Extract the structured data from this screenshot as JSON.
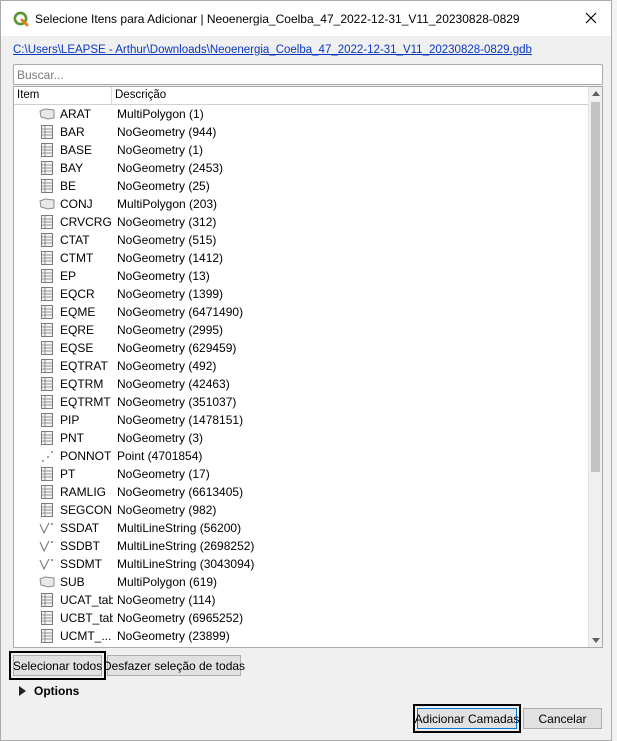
{
  "window": {
    "title": "Selecione Itens para Adicionar | Neoenergia_Coelba_47_2022-12-31_V11_20230828-0829",
    "app_icon": "qgis-icon",
    "close_icon": "close-icon"
  },
  "path": "C:\\Users\\LEAPSE - Arthur\\Downloads\\Neoenergia_Coelba_47_2022-12-31_V11_20230828-0829.gdb",
  "search": {
    "placeholder": "Buscar...",
    "value": ""
  },
  "columns": {
    "item": "Item",
    "description": "Descrição"
  },
  "items": [
    {
      "name": "ARAT",
      "description": "MultiPolygon (1)",
      "icon": "polygon-icon"
    },
    {
      "name": "BAR",
      "description": "NoGeometry (944)",
      "icon": "table-icon"
    },
    {
      "name": "BASE",
      "description": "NoGeometry (1)",
      "icon": "table-icon"
    },
    {
      "name": "BAY",
      "description": "NoGeometry (2453)",
      "icon": "table-icon"
    },
    {
      "name": "BE",
      "description": "NoGeometry (25)",
      "icon": "table-icon"
    },
    {
      "name": "CONJ",
      "description": "MultiPolygon (203)",
      "icon": "polygon-icon"
    },
    {
      "name": "CRVCRG",
      "description": "NoGeometry (312)",
      "icon": "table-icon"
    },
    {
      "name": "CTAT",
      "description": "NoGeometry (515)",
      "icon": "table-icon"
    },
    {
      "name": "CTMT",
      "description": "NoGeometry (1412)",
      "icon": "table-icon"
    },
    {
      "name": "EP",
      "description": "NoGeometry (13)",
      "icon": "table-icon"
    },
    {
      "name": "EQCR",
      "description": "NoGeometry (1399)",
      "icon": "table-icon"
    },
    {
      "name": "EQME",
      "description": "NoGeometry (6471490)",
      "icon": "table-icon"
    },
    {
      "name": "EQRE",
      "description": "NoGeometry (2995)",
      "icon": "table-icon"
    },
    {
      "name": "EQSE",
      "description": "NoGeometry (629459)",
      "icon": "table-icon"
    },
    {
      "name": "EQTRAT",
      "description": "NoGeometry (492)",
      "icon": "table-icon"
    },
    {
      "name": "EQTRM",
      "description": "NoGeometry (42463)",
      "icon": "table-icon"
    },
    {
      "name": "EQTRMT",
      "description": "NoGeometry (351037)",
      "icon": "table-icon"
    },
    {
      "name": "PIP",
      "description": "NoGeometry (1478151)",
      "icon": "table-icon"
    },
    {
      "name": "PNT",
      "description": "NoGeometry (3)",
      "icon": "table-icon"
    },
    {
      "name": "PONNOT",
      "description": "Point (4701854)",
      "icon": "point-icon"
    },
    {
      "name": "PT",
      "description": "NoGeometry (17)",
      "icon": "table-icon"
    },
    {
      "name": "RAMLIG",
      "description": "NoGeometry (6613405)",
      "icon": "table-icon"
    },
    {
      "name": "SEGCON",
      "description": "NoGeometry (982)",
      "icon": "table-icon"
    },
    {
      "name": "SSDAT",
      "description": "MultiLineString (56200)",
      "icon": "line-icon"
    },
    {
      "name": "SSDBT",
      "description": "MultiLineString (2698252)",
      "icon": "line-icon"
    },
    {
      "name": "SSDMT",
      "description": "MultiLineString (3043094)",
      "icon": "line-icon"
    },
    {
      "name": "SUB",
      "description": "MultiPolygon (619)",
      "icon": "polygon-icon"
    },
    {
      "name": "UCAT_tab",
      "description": "NoGeometry (114)",
      "icon": "table-icon"
    },
    {
      "name": "UCBT_tab",
      "description": "NoGeometry (6965252)",
      "icon": "table-icon"
    },
    {
      "name": "UCMT_...",
      "description": "NoGeometry (23899)",
      "icon": "table-icon"
    }
  ],
  "buttons": {
    "select_all": "Selecionar todos",
    "deselect_all": "Desfazer seleção de todas",
    "add_layers": "Adicionar Camadas",
    "cancel": "Cancelar"
  },
  "options_label": "Options"
}
